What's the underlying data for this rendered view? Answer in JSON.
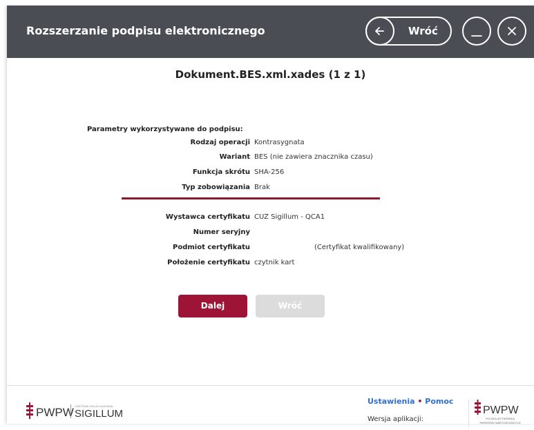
{
  "window": {
    "title": "Rozszerzanie podpisu elektronicznego",
    "back_label": "Wróć"
  },
  "document": {
    "title": "Dokument.BES.xml.xades (1 z 1)"
  },
  "params": {
    "heading": "Parametry wykorzystywane do podpisu:",
    "rows": [
      {
        "label": "Rodzaj operacji",
        "value": "Kontrasygnata"
      },
      {
        "label": "Wariant",
        "value": "BES (nie zawiera znacznika czasu)"
      },
      {
        "label": "Funkcja skrótu",
        "value": "SHA-256"
      },
      {
        "label": "Typ zobowiązania",
        "value": "Brak"
      }
    ]
  },
  "certificate": {
    "rows": [
      {
        "label": "Wystawca certyfikatu",
        "value": "CUZ Sigillum - QCA1"
      },
      {
        "label": "Numer seryjny",
        "value": ""
      },
      {
        "label": "Podmiot certyfikatu",
        "value": "(Certyfikat kwalifikowany)"
      },
      {
        "label": "Położenie certyfikatu",
        "value": "czytnik kart"
      }
    ]
  },
  "buttons": {
    "next": "Dalej",
    "back": "Wróć"
  },
  "footer": {
    "logo_text": "PWPW",
    "logo_small": "CENTRUM USŁUG ZAUFANIA",
    "logo_product": "SIGILLUM",
    "settings_link": "Ustawienia",
    "separator": "•",
    "help_link": "Pomoc",
    "version_label": "Wersja aplikacji:",
    "right_logo_text": "PWPW",
    "right_logo_sub1": "POLSKA WYTWÓRNIA",
    "right_logo_sub2": "PAPIERÓW WARTOŚCIOWYCH"
  },
  "colors": {
    "titlebar": "#4a4e54",
    "accent": "#9d1437",
    "link": "#2f6fcf"
  }
}
